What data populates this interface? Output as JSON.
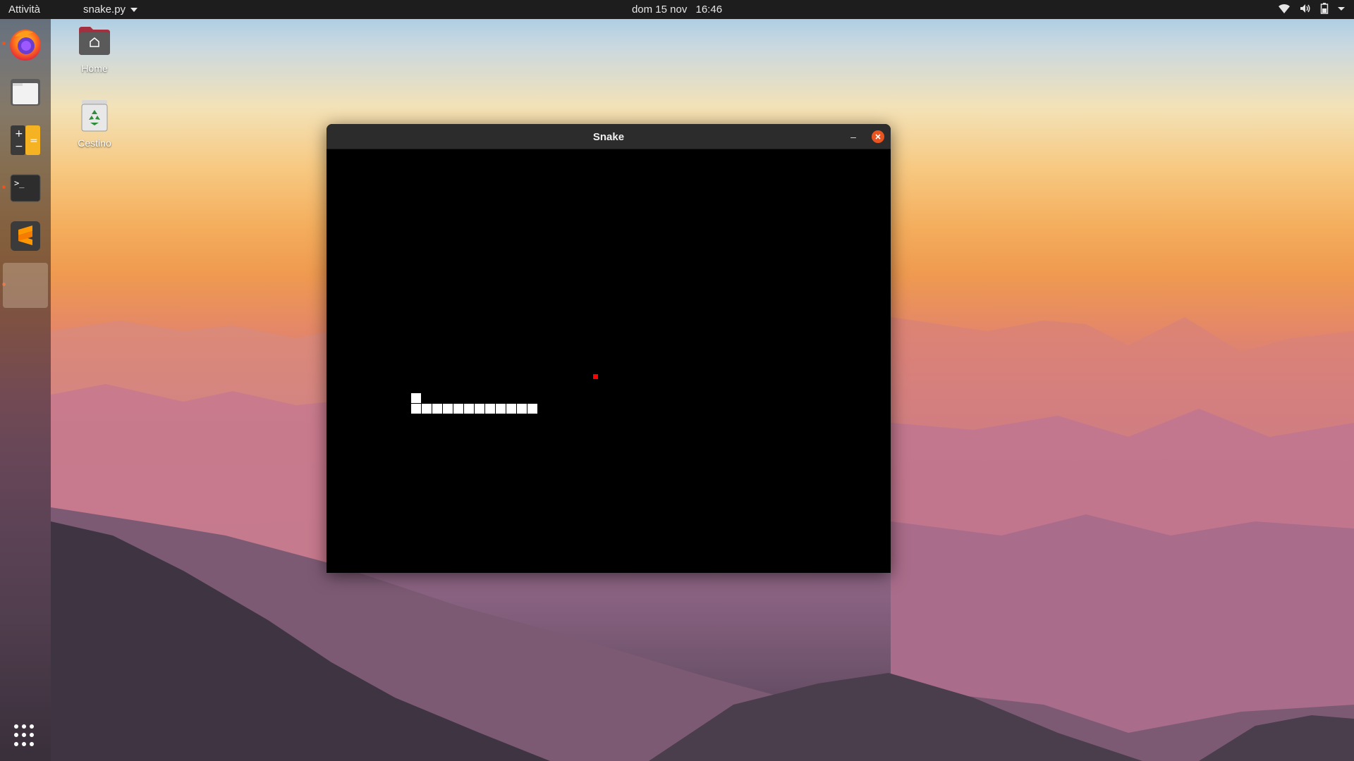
{
  "topbar": {
    "activities": "Attività",
    "app_name": "snake.py",
    "date": "dom 15 nov",
    "time": "16:46",
    "tray_icons": [
      "wifi-icon",
      "volume-icon",
      "battery-icon",
      "system-menu-caret-icon"
    ]
  },
  "dock": {
    "items": [
      "firefox-icon",
      "files-icon",
      "calculator-icon",
      "terminal-icon",
      "sublime-text-icon",
      "snake-app-icon"
    ],
    "apps_grid": "show-applications-icon"
  },
  "desktop": {
    "icons": [
      {
        "label": "Home",
        "icon": "home-folder-icon"
      },
      {
        "label": "Cestino",
        "icon": "trash-icon"
      }
    ]
  },
  "window": {
    "title": "Snake",
    "minimize_glyph": "–",
    "close_icon": "close-icon"
  },
  "game": {
    "grid_size": 15,
    "snake": [
      {
        "col": 8,
        "row": 23
      },
      {
        "col": 8,
        "row": 24
      },
      {
        "col": 9,
        "row": 24
      },
      {
        "col": 10,
        "row": 24
      },
      {
        "col": 11,
        "row": 24
      },
      {
        "col": 12,
        "row": 24
      },
      {
        "col": 13,
        "row": 24
      },
      {
        "col": 14,
        "row": 24
      },
      {
        "col": 15,
        "row": 24
      },
      {
        "col": 16,
        "row": 24
      },
      {
        "col": 17,
        "row": 24
      },
      {
        "col": 18,
        "row": 24
      },
      {
        "col": 19,
        "row": 24
      }
    ],
    "food": {
      "col": 25,
      "row": 21
    },
    "colors": {
      "snake": "#ffffff",
      "food": "#ff0000",
      "background": "#000000"
    }
  }
}
